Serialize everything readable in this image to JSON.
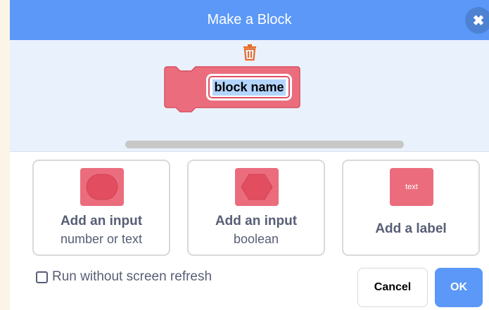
{
  "dialog": {
    "title": "Make a Block",
    "close_icon": "close-icon",
    "header_color": "#5b98f7"
  },
  "workspace": {
    "trash_icon": "trash-icon",
    "block_name": "block name",
    "block_color": "#eb6d7d",
    "scrollbar": "horizontal-scrollbar"
  },
  "options": [
    {
      "title": "Add an input",
      "subtitle": "number or text",
      "icon": "number-input-icon"
    },
    {
      "title": "Add an input",
      "subtitle": "boolean",
      "icon": "boolean-input-icon"
    },
    {
      "title": "Add a label",
      "icon": "label-icon",
      "icon_text": "text"
    }
  ],
  "footer": {
    "checkbox_label": "Run without screen refresh",
    "checked": false,
    "cancel_label": "Cancel",
    "ok_label": "OK",
    "ok_color": "#5b98f7"
  }
}
